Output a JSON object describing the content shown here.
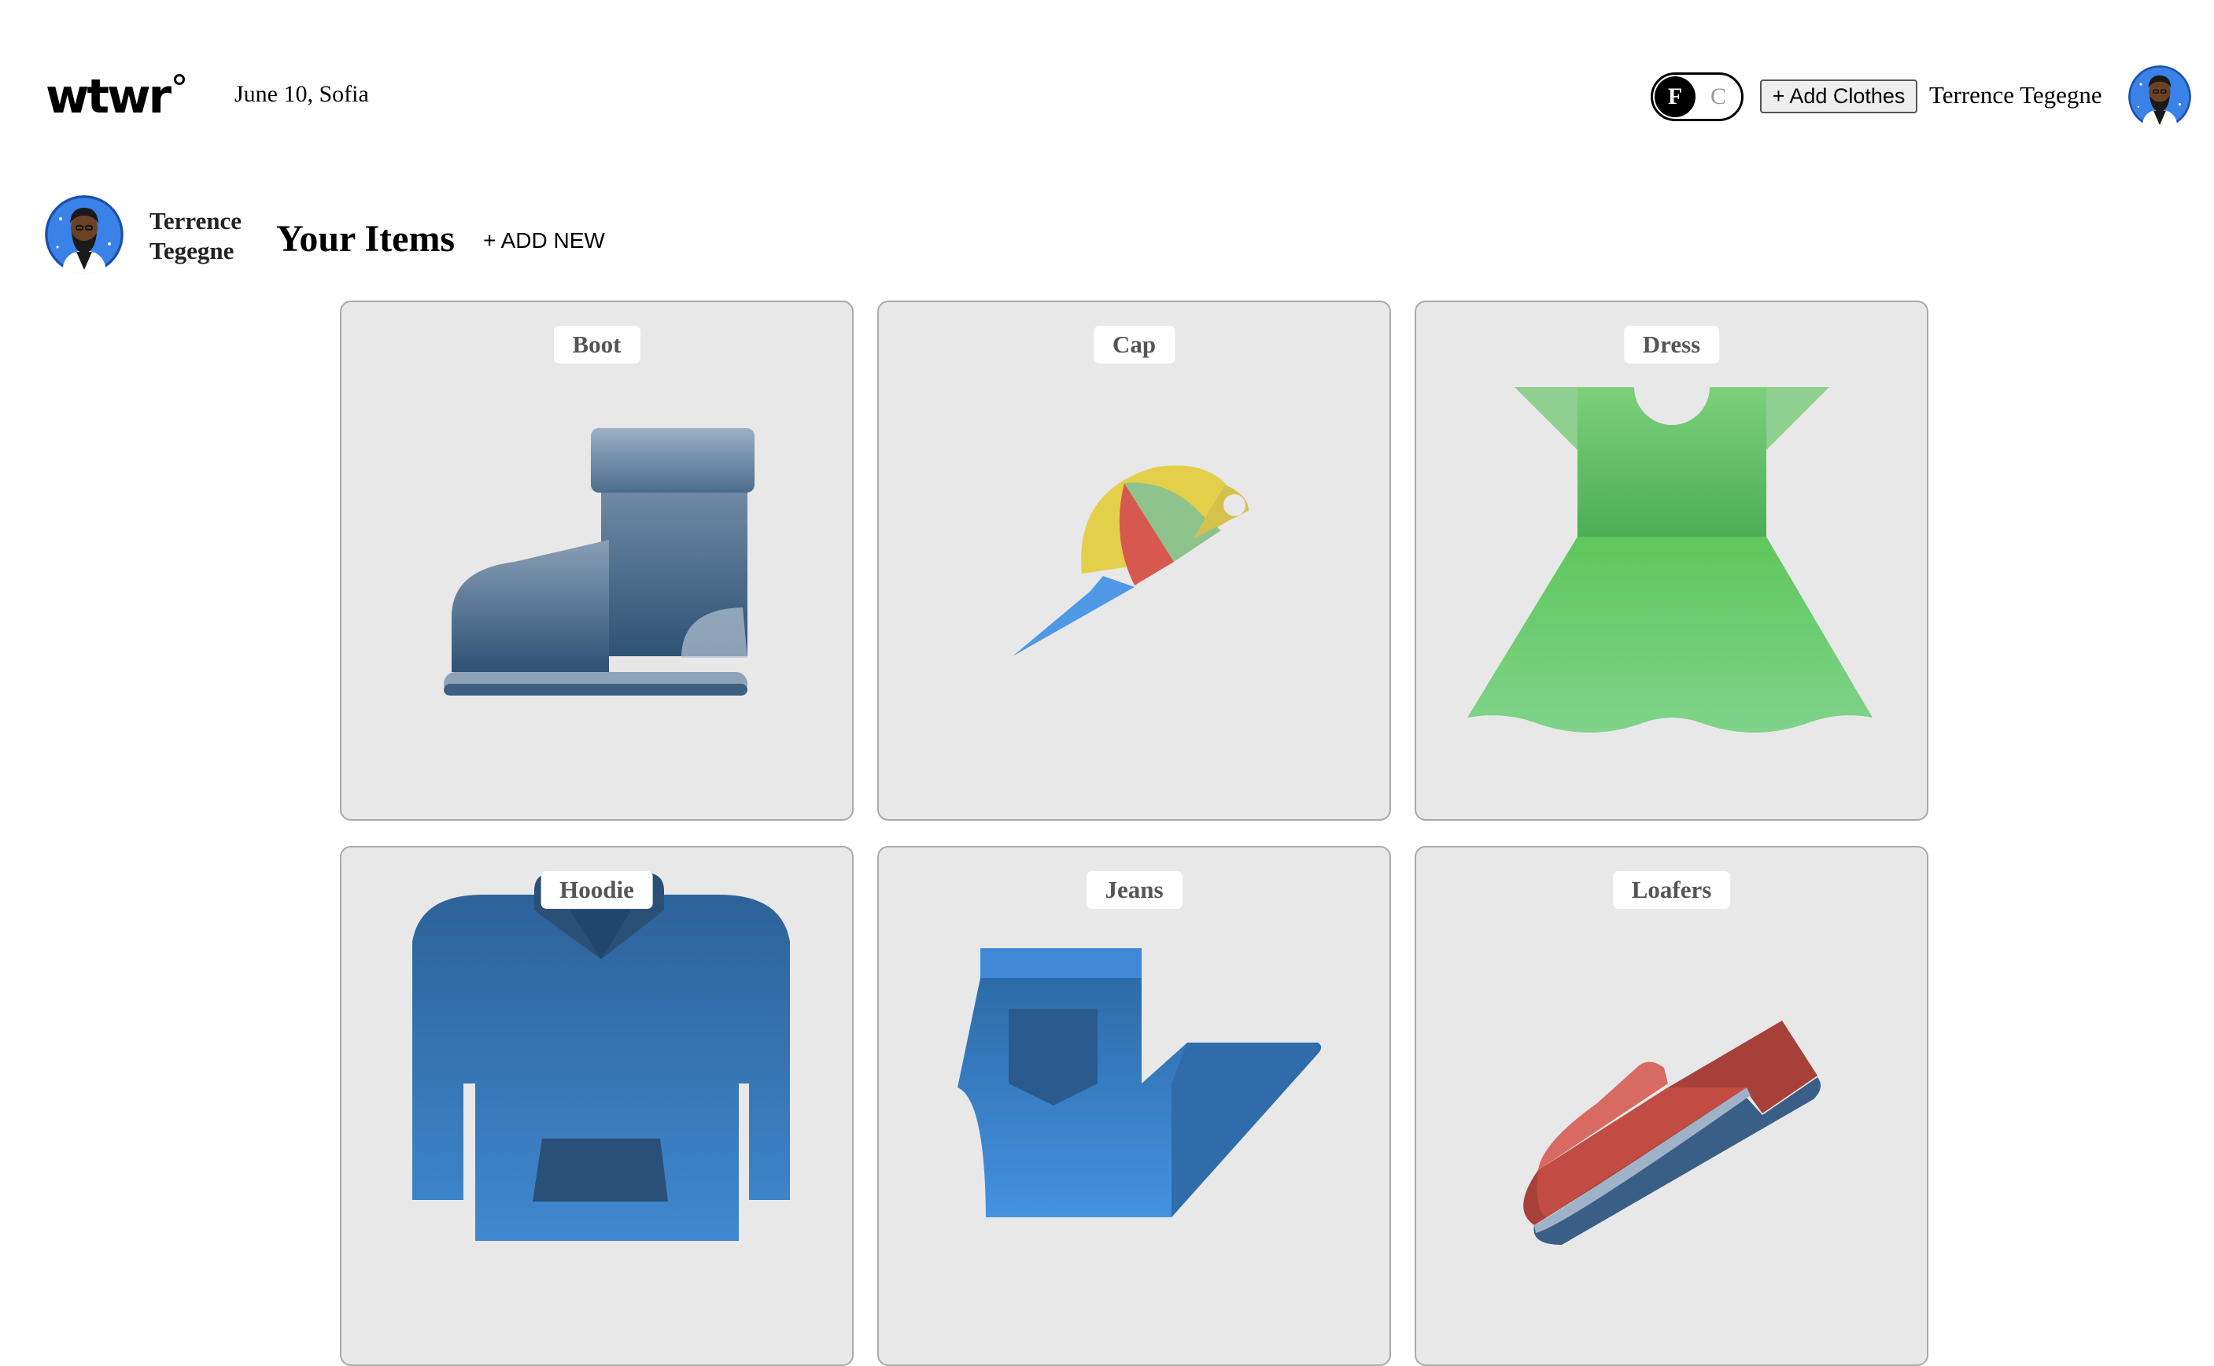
{
  "header": {
    "logo": "wtwr",
    "date_location": "June 10, Sofia",
    "toggle": {
      "f": "F",
      "c": "C",
      "selected": "F"
    },
    "add_clothes": "+ Add Clothes",
    "username": "Terrence Tegegne"
  },
  "sidebar": {
    "name_line1": "Terrence",
    "name_line2": "Tegegne"
  },
  "main": {
    "title": "Your Items",
    "add_new": "+ ADD NEW",
    "items": [
      {
        "name": "Boot",
        "icon": "boot-icon"
      },
      {
        "name": "Cap",
        "icon": "cap-icon"
      },
      {
        "name": "Dress",
        "icon": "dress-icon"
      },
      {
        "name": "Hoodie",
        "icon": "hoodie-icon"
      },
      {
        "name": "Jeans",
        "icon": "jeans-icon"
      },
      {
        "name": "Loafers",
        "icon": "loafers-icon"
      }
    ]
  },
  "colors": {
    "accent": "#000000",
    "card_bg": "#e8e8e8",
    "avatar_bg": "#3b82e8"
  }
}
